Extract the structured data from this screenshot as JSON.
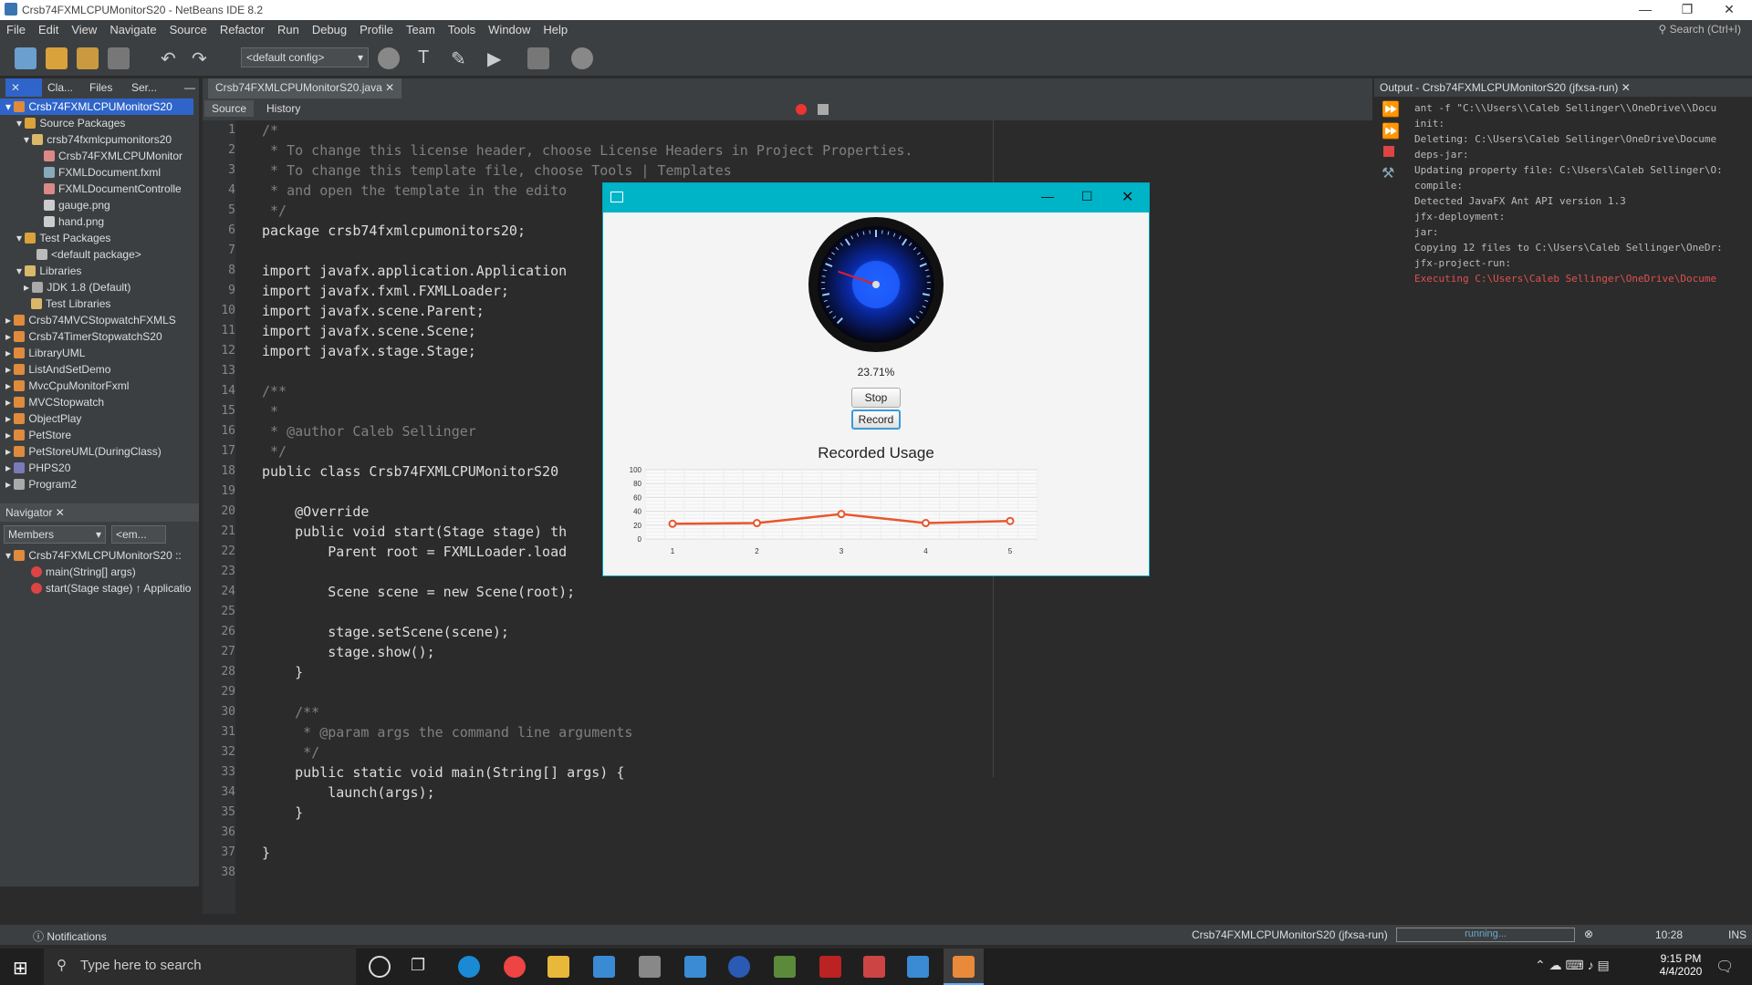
{
  "window": {
    "title": "Crsb74FXMLCPUMonitorS20 - NetBeans IDE 8.2"
  },
  "menu": [
    "File",
    "Edit",
    "View",
    "Navigate",
    "Source",
    "Refactor",
    "Run",
    "Debug",
    "Profile",
    "Team",
    "Tools",
    "Window",
    "Help"
  ],
  "search": {
    "placeholder": "Search (Ctrl+I)"
  },
  "toolbar": {
    "config": "<default config>"
  },
  "projects": {
    "tabs": [
      "Cla...",
      "Files",
      "Ser..."
    ],
    "items": [
      "Crsb74FXMLCPUMonitorS20",
      "Source Packages",
      "crsb74fxmlcpumonitors20",
      "Crsb74FXMLCPUMonitor",
      "FXMLDocument.fxml",
      "FXMLDocumentControlle",
      "gauge.png",
      "hand.png",
      "Test Packages",
      "<default package>",
      "Libraries",
      "JDK 1.8 (Default)",
      "Test Libraries",
      "Crsb74MVCStopwatchFXMLS",
      "Crsb74TimerStopwatchS20",
      "LibraryUML",
      "ListAndSetDemo",
      "MvcCpuMonitorFxml",
      "MVCStopwatch",
      "ObjectPlay",
      "PetStore",
      "PetStoreUML(DuringClass)",
      "PHPS20",
      "Program2"
    ]
  },
  "navigator": {
    "title": "Navigator",
    "filter": "Members",
    "filter2": "<em...",
    "root": "Crsb74FXMLCPUMonitorS20 ::",
    "members": [
      "main(String[] args)",
      "start(Stage stage) ↑ Applicatio"
    ]
  },
  "editor": {
    "tab": "Crsb74FXMLCPUMonitorS20.java",
    "source_tab": "Source",
    "history_tab": "History"
  },
  "code": [
    "/*",
    " * To change this license header, choose License Headers in Project Properties.",
    " * To change this template file, choose Tools | Templates",
    " * and open the template in the edito",
    " */",
    "package crsb74fxmlcpumonitors20;",
    "",
    "import javafx.application.Application",
    "import javafx.fxml.FXMLLoader;",
    "import javafx.scene.Parent;",
    "import javafx.scene.Scene;",
    "import javafx.stage.Stage;",
    "",
    "/**",
    " *",
    " * @author Caleb Sellinger",
    " */",
    "public class Crsb74FXMLCPUMonitorS20",
    "",
    "    @Override",
    "    public void start(Stage stage) th",
    "        Parent root = FXMLLoader.load",
    "",
    "        Scene scene = new Scene(root);",
    "",
    "        stage.setScene(scene);",
    "        stage.show();",
    "    }",
    "",
    "    /**",
    "     * @param args the command line arguments",
    "     */",
    "    public static void main(String[] args) {",
    "        launch(args);",
    "    }",
    "",
    "}",
    ""
  ],
  "output": {
    "title": "Output - Crsb74FXMLCPUMonitorS20 (jfxsa-run)",
    "lines": [
      "ant -f \"C:\\\\Users\\\\Caleb Sellinger\\\\OneDrive\\\\Docu",
      "init:",
      "Deleting: C:\\Users\\Caleb Sellinger\\OneDrive\\Docume",
      "deps-jar:",
      "Updating property file: C:\\Users\\Caleb Sellinger\\O:",
      "compile:",
      "Detected JavaFX Ant API version 1.3",
      "jfx-deployment:",
      "jar:",
      "Copying 12 files to C:\\Users\\Caleb Sellinger\\OneDr:",
      "jfx-project-run:",
      "Executing C:\\Users\\Caleb Sellinger\\OneDrive\\Docume"
    ]
  },
  "fx": {
    "percent": "23.71%",
    "stop": "Stop",
    "record": "Record",
    "chart_title": "Recorded Usage"
  },
  "chart_data": {
    "type": "line",
    "title": "Recorded Usage",
    "x": [
      1,
      2,
      3,
      4,
      5
    ],
    "y": [
      22,
      23,
      36,
      23,
      26
    ],
    "ylim": [
      0,
      100
    ],
    "yticks": [
      "100",
      "80",
      "60",
      "40",
      "20",
      "0"
    ],
    "xticks": [
      "1",
      "2",
      "3",
      "4",
      "5"
    ],
    "grid": true,
    "color": "#e8572e"
  },
  "gauge": {
    "value": 0.2371
  },
  "status": {
    "notifications": "Notifications",
    "project": "Crsb74FXMLCPUMonitorS20 (jfxsa-run)",
    "progress": "running...",
    "pos": "10:28",
    "mode": "INS"
  },
  "taskbar": {
    "search": "Type here to search",
    "time": "9:15 PM",
    "date": "4/4/2020"
  }
}
